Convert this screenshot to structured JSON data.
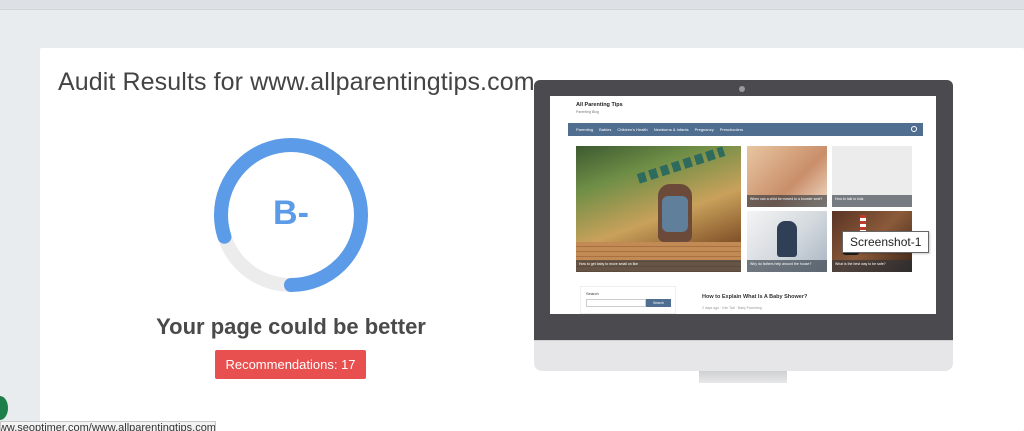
{
  "audit": {
    "title": "Audit Results for www.allparentingtips.com",
    "grade": "B-",
    "score_fraction": 0.8,
    "headline": "Your page could be better",
    "recommendations_label": "Recommendations: 17"
  },
  "colors": {
    "gauge_fill": "#5b9be8",
    "gauge_track": "#ececec",
    "button": "#e84f4f",
    "site_nav": "#4f6e90"
  },
  "preview": {
    "site_title": "All Parenting Tips",
    "site_tagline": "Parenting Blog",
    "nav_items": [
      "Parenting",
      "Babies",
      "Children's Health",
      "Newborns & Infants",
      "Pregnancy",
      "Preschoolers"
    ],
    "hero_caption": "How to get baby to move small on like",
    "thumb_captions": [
      "When can a child be moved to a booster seat?",
      "How to talk to kids",
      "Why do fathers help around the house?",
      "What is the best way to be safe?"
    ],
    "sidebar_search_label": "Search",
    "sidebar_search_button": "Search",
    "post_title": "How to Explain What Is A Baby Shower?",
    "post_meta": "2 days ago  ·  Kim Tait  ·  Baby Parenting"
  },
  "tooltip": "Screenshot-1",
  "status_url": "www.seoptimer.com/www.allparentingtips.com#"
}
